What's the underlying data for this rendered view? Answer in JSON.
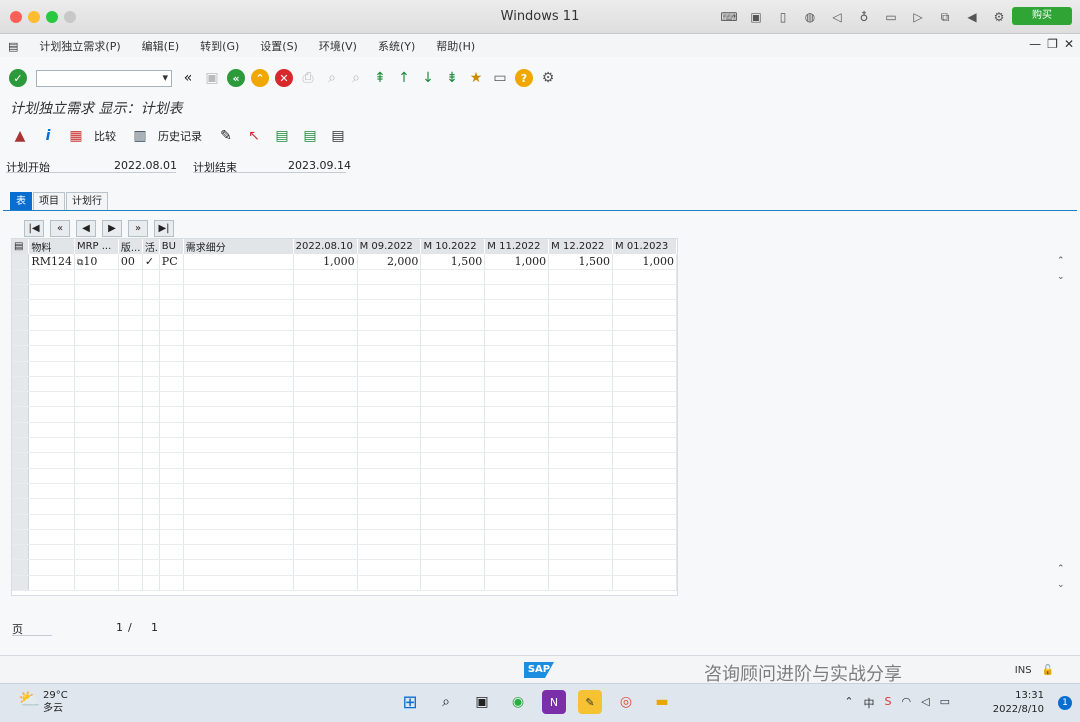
{
  "window": {
    "title": "Windows 11",
    "buy_label": "购买"
  },
  "menu": [
    "计划独立需求(P)",
    "编辑(E)",
    "转到(G)",
    "设置(S)",
    "环境(V)",
    "系统(Y)",
    "帮助(H)"
  ],
  "page": {
    "title": "计划独立需求 显示：计划表"
  },
  "app_toolbar": {
    "compare_label": "比较",
    "history_label": "历史记录"
  },
  "fields": {
    "plan_start_label": "计划开始",
    "plan_start_value": "2022.08.01",
    "plan_end_label": "计划结束",
    "plan_end_value": "2023.09.14"
  },
  "tabs": [
    "表",
    "项目",
    "计划行"
  ],
  "grid": {
    "headers": [
      "物料",
      "MRP ...",
      "版...",
      "活.",
      "BU",
      "需求细分",
      "2022.08.10",
      "M 09.2022",
      "M 10.2022",
      "M 11.2022",
      "M 12.2022",
      "M 01.2023"
    ],
    "row": [
      "RM124",
      "10",
      "00",
      "✓",
      "PC",
      "",
      "1,000",
      "2,000",
      "1,500",
      "1,000",
      "1,500",
      "1,000"
    ]
  },
  "pager": {
    "label": "页",
    "current": "1",
    "separator": "/",
    "total": "1"
  },
  "status": {
    "sap": "SAP",
    "watermark": "咨询顾问进阶与实战分享",
    "mode": "INS"
  },
  "taskbar": {
    "temperature": "29°C",
    "weather": "多云",
    "time": "13:31",
    "date": "2022/8/10",
    "notifications": "1",
    "ime": "中"
  }
}
